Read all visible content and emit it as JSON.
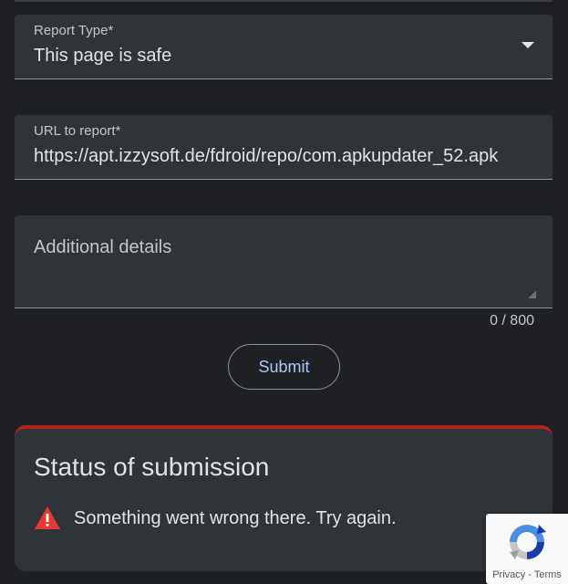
{
  "report_type": {
    "label": "Report Type*",
    "value": "This page is safe",
    "icon": "dropdown-arrow-icon"
  },
  "url_field": {
    "label": "URL to report*",
    "value": "https://apt.izzysoft.de/fdroid/repo/com.apkupdater_52.apk"
  },
  "details_field": {
    "placeholder": "Additional details",
    "counter": "0 / 800"
  },
  "submit": {
    "label": "Submit"
  },
  "status": {
    "title": "Status of submission",
    "message": "Something went wrong there. Try again.",
    "icon": "warning-icon",
    "error_color": "#e53935"
  },
  "recaptcha": {
    "privacy": "Privacy",
    "separator": " - ",
    "terms": "Terms"
  },
  "colors": {
    "background": "#1f2023",
    "field": "#2f3438",
    "accent": "#a8c7fa",
    "error_border": "#b3261e"
  }
}
